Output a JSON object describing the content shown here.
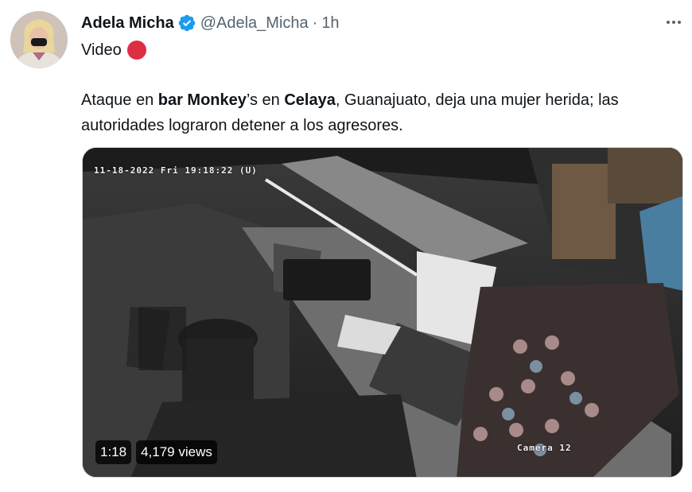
{
  "tweet": {
    "author": {
      "name": "Adela Micha",
      "handle": "@Adela_Micha",
      "verified": true,
      "avatar_icon": "profile-photo"
    },
    "separator": "·",
    "time": "1h",
    "first_line": "Video",
    "first_line_icon": "red-circle-emoji",
    "text_parts": [
      {
        "t": "Ataque en ",
        "bold": false
      },
      {
        "t": "bar Monkey",
        "bold": true
      },
      {
        "t": "’s en ",
        "bold": false
      },
      {
        "t": "Celaya",
        "bold": true
      },
      {
        "t": ", Guanajuato, deja una mujer herida; las autoridades lograron detener a los agresores.",
        "bold": false
      }
    ]
  },
  "video": {
    "timestamp_overlay": "11-18-2022 Fri 19:18:22 (U)",
    "camera_label": "Camera 12",
    "duration": "1:18",
    "views": "4,179 views"
  },
  "colors": {
    "text": "#0f1419",
    "secondary": "#536471",
    "verified_blue": "#1d9bf0",
    "red_dot": "#dd2e44"
  }
}
